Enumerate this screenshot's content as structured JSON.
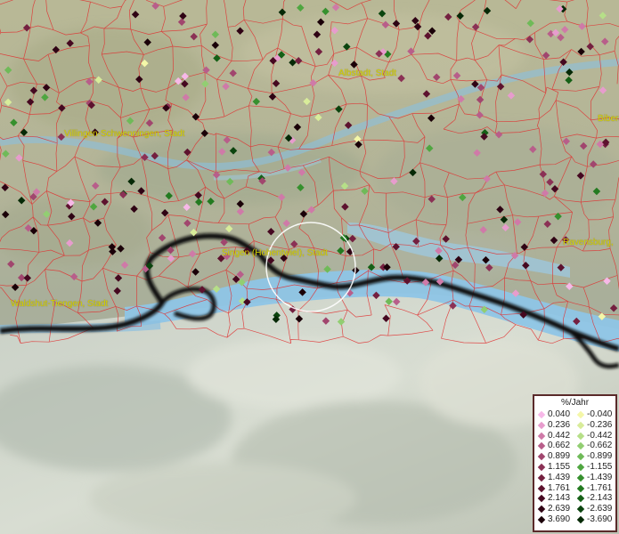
{
  "map": {
    "cities": [
      {
        "name": "Albstadt, Stadt"
      },
      {
        "name": "Villingen-Schwenningen, Stadt"
      },
      {
        "name": "Bibera"
      },
      {
        "name": "Singen (Hohentwiel), Stadt"
      },
      {
        "name": "Ravensburg,"
      },
      {
        "name": "Waldshut-Tiengen, Stadt"
      }
    ],
    "colors": {
      "positive_low": "#f7b8e8",
      "positive_high": "#1a0008",
      "negative_low": "#f4f7a8",
      "negative_high": "#062006",
      "boundaries": "#e03030",
      "lake": "#8fc8e8",
      "border_line": "#111111"
    }
  },
  "legend": {
    "title": "%/Jahr",
    "rows": [
      {
        "pos": "0.040",
        "neg": "-0.040",
        "pos_color": "#f7b8e8",
        "neg_color": "#f4f7a8"
      },
      {
        "pos": "0.236",
        "neg": "-0.236",
        "pos_color": "#e79ccd",
        "neg_color": "#d8ec9a"
      },
      {
        "pos": "0.442",
        "neg": "-0.442",
        "pos_color": "#cf7aa8",
        "neg_color": "#b6df88"
      },
      {
        "pos": "0.662",
        "neg": "-0.662",
        "pos_color": "#b85e8a",
        "neg_color": "#92ce72"
      },
      {
        "pos": "0.899",
        "neg": "-0.899",
        "pos_color": "#a1466e",
        "neg_color": "#6fba58"
      },
      {
        "pos": "1.155",
        "neg": "-1.155",
        "pos_color": "#8b3155",
        "neg_color": "#4fa640"
      },
      {
        "pos": "1.439",
        "neg": "-1.439",
        "pos_color": "#742040",
        "neg_color": "#36902e"
      },
      {
        "pos": "1.761",
        "neg": "-1.761",
        "pos_color": "#5d122e",
        "neg_color": "#237a20"
      },
      {
        "pos": "2.143",
        "neg": "-2.143",
        "pos_color": "#450820",
        "neg_color": "#156016"
      },
      {
        "pos": "2.639",
        "neg": "-2.639",
        "pos_color": "#2f0314",
        "neg_color": "#0b440e"
      },
      {
        "pos": "3.690",
        "neg": "-3.690",
        "pos_color": "#1a0008",
        "neg_color": "#062906"
      }
    ]
  }
}
